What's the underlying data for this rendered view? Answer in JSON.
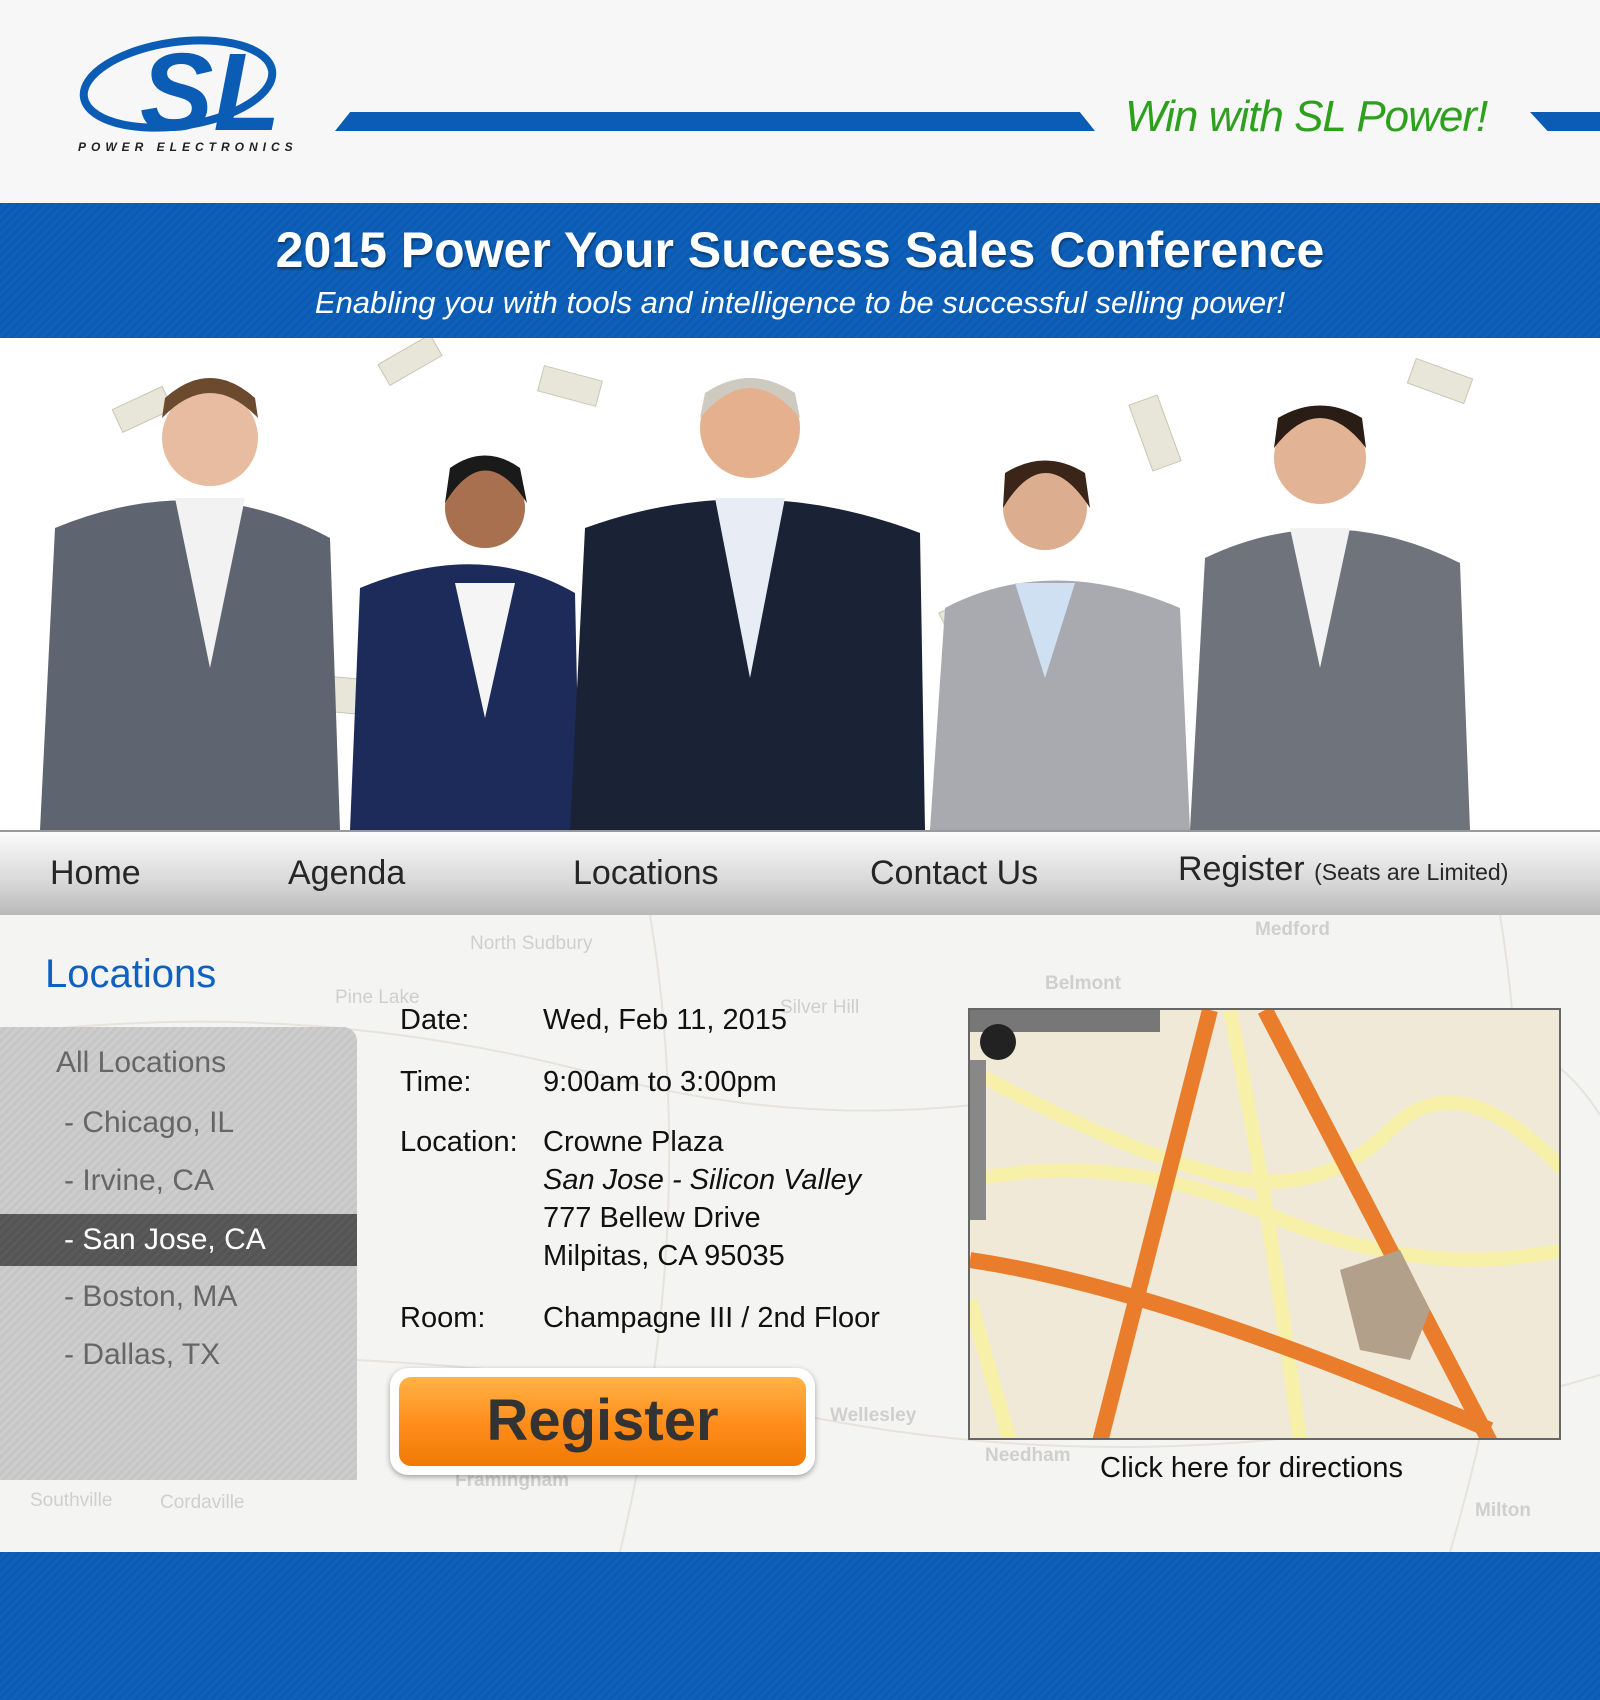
{
  "header": {
    "logo_text": "SL",
    "logo_subtext": "POWER ELECTRONICS",
    "slogan": "Win with SL Power!"
  },
  "banner": {
    "title": "2015 Power Your Success  Sales Conference",
    "subtitle": "Enabling you with tools and intelligence to be successful selling power!"
  },
  "nav": {
    "items": [
      {
        "label": "Home"
      },
      {
        "label": "Agenda"
      },
      {
        "label": "Locations"
      },
      {
        "label": "Contact Us"
      },
      {
        "label": "Register"
      }
    ],
    "register_note": "(Seats are Limited)"
  },
  "sidebar": {
    "heading": "Locations",
    "items": [
      {
        "label": "All Locations"
      },
      {
        "label": "- Chicago, IL"
      },
      {
        "label": "- Irvine, CA"
      },
      {
        "label": "- San Jose, CA",
        "selected": true
      },
      {
        "label": "- Boston, MA"
      },
      {
        "label": "- Dallas, TX"
      }
    ]
  },
  "details": {
    "date_label": "Date:",
    "date": "Wed, Feb 11, 2015",
    "time_label": "Time:",
    "time": "9:00am to 3:00pm",
    "location_label": "Location:",
    "venue": "Crowne Plaza",
    "venue_sub": "San Jose - Silicon Valley",
    "address1": "777 Bellew Drive",
    "address2": "Milpitas, CA 95035",
    "room_label": "Room:",
    "room": "Champagne III / 2nd Floor"
  },
  "register_button": "Register",
  "map": {
    "directions_link": "Click here for directions"
  },
  "colors": {
    "brand_blue": "#0b5bb3",
    "slogan_green": "#2ea01e",
    "register_orange": "#ff8c1a",
    "heading_blue": "#1060c0"
  }
}
